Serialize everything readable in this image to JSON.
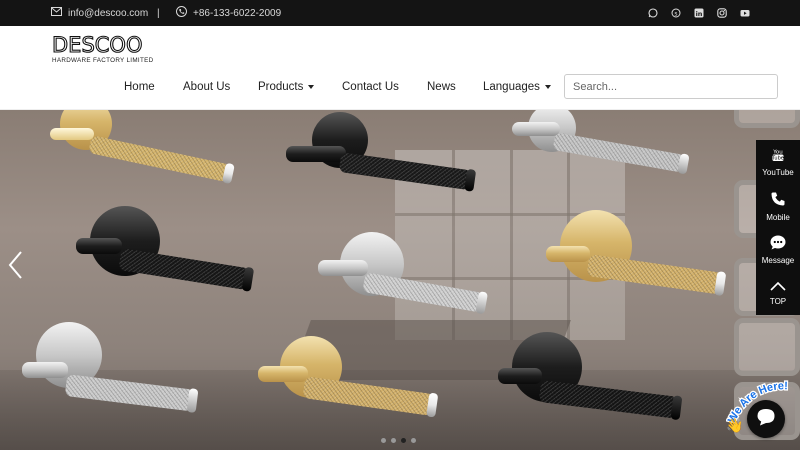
{
  "topbar": {
    "email": "info@descoo.com",
    "separator": "|",
    "phone": "+86-133-6022-2009",
    "social_icons": [
      "whatsapp-icon",
      "skype-icon",
      "linkedin-icon",
      "instagram-icon",
      "youtube-icon"
    ]
  },
  "logo": {
    "wordmark": "DESCOO",
    "tagline": "HARDWARE FACTORY LIMITED"
  },
  "nav": {
    "items": [
      {
        "label": "Home"
      },
      {
        "label": "About Us"
      },
      {
        "label": "Products"
      },
      {
        "label": "Contact Us"
      },
      {
        "label": "News"
      },
      {
        "label": "Languages"
      }
    ]
  },
  "search": {
    "placeholder": "Search..."
  },
  "carousel": {
    "dots": 4,
    "active_dot": 3,
    "handle_finishes": [
      "gold",
      "black",
      "silver",
      "black",
      "silver",
      "gold",
      "silver",
      "gold",
      "black"
    ]
  },
  "sidebar": {
    "items": [
      {
        "label": "YouTube",
        "icon": "youtube-icon"
      },
      {
        "label": "Mobile",
        "icon": "phone-icon"
      },
      {
        "label": "Message",
        "icon": "chat-bubble-icon"
      },
      {
        "label": "TOP",
        "icon": "chevron-up-icon"
      }
    ]
  },
  "chat": {
    "badge_text": "We Are Here!",
    "accent": "#1a73e8"
  },
  "colors": {
    "topbar_bg": "#141414",
    "sidebar_bg": "#0e0e0e",
    "gold": "#d6b56a"
  }
}
